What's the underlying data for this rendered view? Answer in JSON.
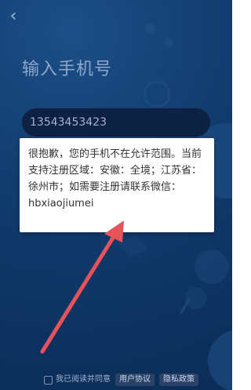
{
  "header": {
    "title": "输入手机号",
    "back_icon": "chevron-left-icon"
  },
  "form": {
    "phone_value": "13543453423",
    "code_placeholder": "",
    "captcha_image": "captcha-image"
  },
  "dialog": {
    "message": "很抱歉，您的手机不在允许范围。当前支持注册区域：安徽：全境；江苏省：徐州市；如需要注册请联系微信：hbxiaojiumei"
  },
  "footer": {
    "agree_text": "我已阅读并同意",
    "user_agreement": "用户协议",
    "privacy_policy": "隐私政策"
  },
  "colors": {
    "background": "#123d70",
    "field_bg": "#0d2143",
    "dialog_bg": "#ffffff",
    "arrow": "#e8525a"
  }
}
